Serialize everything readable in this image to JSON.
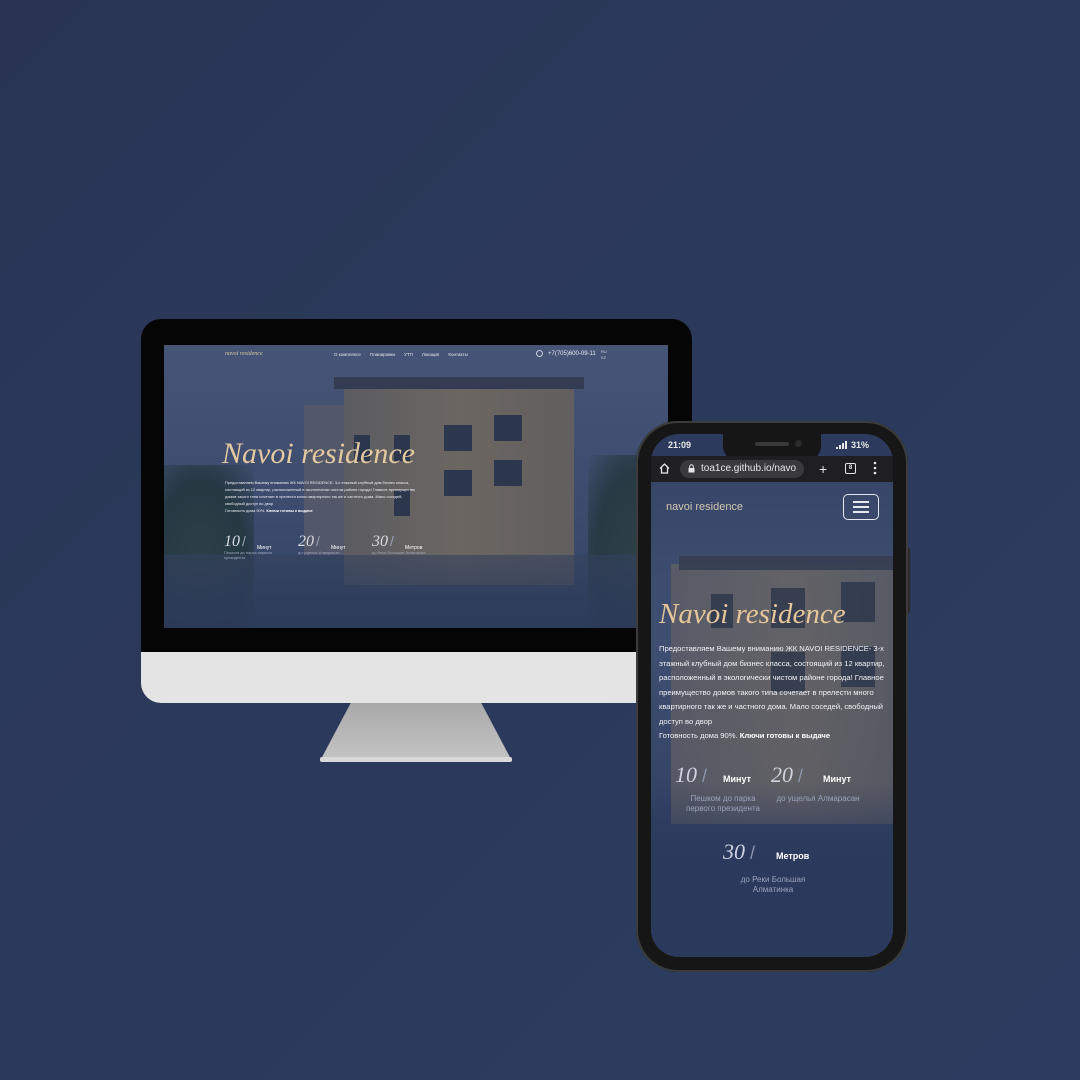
{
  "desktop": {
    "logo": "navoi residence",
    "menu": [
      "О комплексе",
      "Планировки",
      "УТП",
      "Локация",
      "Контакты"
    ],
    "phone": "+7(705)600-09-11",
    "lang": [
      "RU",
      "KZ"
    ],
    "title": "Navoi residence",
    "description": "Предоставляем Вашему вниманию ЖК NAVOI RESIDENCE- 3-х этажный клубный дом бизнес класса, состоящий из 12 квартир, расположенный в экологически чистом районе города! Главное преимущество домов такого типа сочетает в прелести много квартирного так же и частного дома. Мало соседей, свободный доступ во двор",
    "readiness": "Готовность дома 90%.",
    "keys": "Ключи готовы к выдаче",
    "stats": [
      {
        "num": "10",
        "unit": "Минут",
        "caption": "Пешком до парка первого президента"
      },
      {
        "num": "20",
        "unit": "Минут",
        "caption": "до ущелья Алмарасан"
      },
      {
        "num": "30",
        "unit": "Метров",
        "caption": "до Реки Большая Алматинка"
      }
    ]
  },
  "mobile": {
    "status_time": "21:09",
    "status_battery": "31%",
    "url": "toa1ce.github.io/navo",
    "tab_count": "8",
    "logo": "navoi residence",
    "title": "Navoi residence",
    "description": "Предоставляем Вашему вниманию ЖК NAVOI RESIDENCE- 3-х этажный клубный дом бизнес класса, состоящий из 12 квартир, расположенный в экологически чистом районе города! Главное преимущество домов такого типа сочетает в прелести много квартирного так же и частного дома. Мало соседей, свободный доступ во двор",
    "readiness": "Готовность дома 90%.",
    "keys": "Ключи готовы к выдаче",
    "stats": [
      {
        "num": "10",
        "unit": "Минут",
        "caption_1": "Пешком до парка",
        "caption_2": "первого президента"
      },
      {
        "num": "20",
        "unit": "Минут",
        "caption_1": "до ущелья Алмарасан",
        "caption_2": ""
      },
      {
        "num": "30",
        "unit": "Метров",
        "caption_1": "до Реки Большая",
        "caption_2": "Алматинка"
      }
    ]
  },
  "colors": {
    "background": "#2b3a5c",
    "accent_gold": "#e4c9a0",
    "text_light": "#eeeef3"
  }
}
